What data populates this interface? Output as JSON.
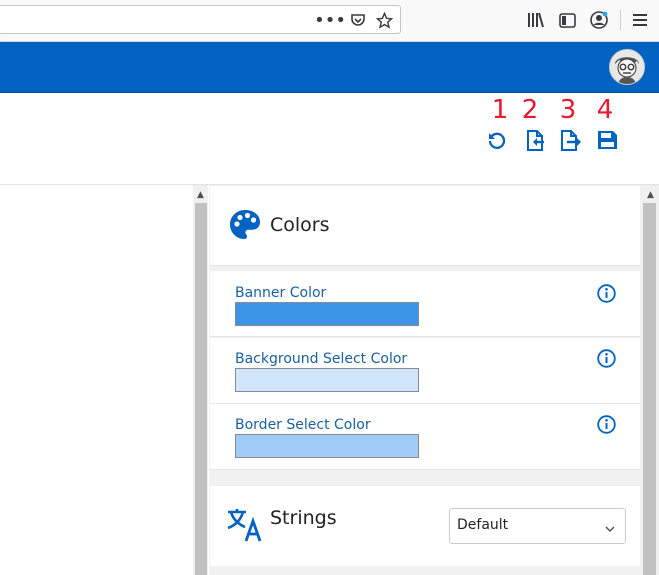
{
  "browser": {
    "toolbar_icons": [
      "more-actions-icon",
      "pocket-icon",
      "bookmark-star-icon",
      "library-icon",
      "sidebar-icon",
      "account-icon",
      "menu-icon"
    ]
  },
  "actions": {
    "markers": [
      "1",
      "2",
      "3",
      "4"
    ],
    "icons": [
      "reset-icon",
      "import-icon",
      "export-icon",
      "save-icon"
    ],
    "marker_color": "#e8192c",
    "icon_color": "#0263c2"
  },
  "colors_section": {
    "title": "Colors",
    "fields": [
      {
        "label": "Banner Color",
        "value": "#3d95ea"
      },
      {
        "label": "Background Select Color",
        "value": "#cfe6fd"
      },
      {
        "label": "Border Select Color",
        "value": "#9fcbf8"
      }
    ]
  },
  "strings_section": {
    "title": "Strings",
    "language": "Default"
  },
  "theme": {
    "banner": "#0263c2"
  }
}
